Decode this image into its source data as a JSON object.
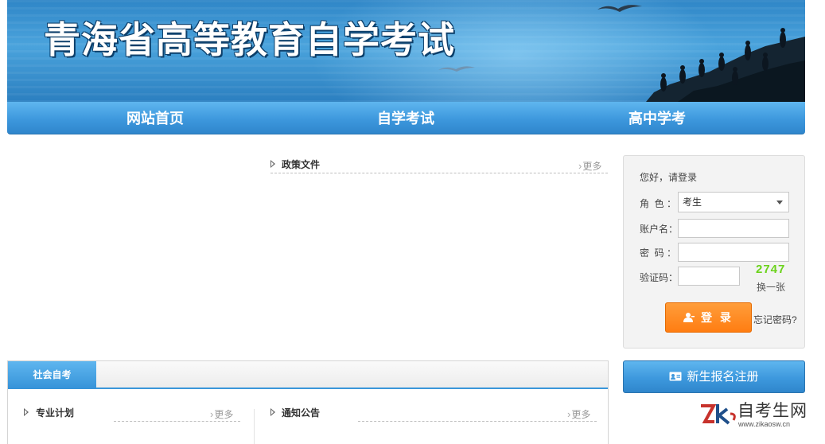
{
  "banner": {
    "title": "青海省高等教育自学考试"
  },
  "nav": {
    "items": [
      "网站首页",
      "自学考试",
      "高中学考"
    ]
  },
  "policy": {
    "title": "政策文件",
    "more": "更多"
  },
  "login": {
    "greeting": "您好，请登录",
    "role_label": "角  色 ：",
    "role_value": "考生",
    "account_label": "账户名：",
    "account_value": "",
    "password_label": "密  码 ：",
    "password_value": "",
    "captcha_label": "验证码：",
    "captcha_value": "",
    "captcha_code": "2747",
    "captcha_refresh": "换一张",
    "submit": "登 录",
    "forgot": "忘记密码?"
  },
  "register": {
    "label": "新生报名注册"
  },
  "panel": {
    "tab": "社会自考",
    "left": {
      "title": "专业计划",
      "more": "更多"
    },
    "right": {
      "title": "通知公告",
      "more": "更多"
    }
  },
  "watermark": {
    "name": "自考生网",
    "url": "www.zikaosw.cn"
  },
  "colors": {
    "primary_blue": "#3d98dd",
    "login_orange": "#ff8a20",
    "captcha_green": "#6bd31b"
  },
  "icons": {
    "login": "user-icon",
    "register": "id-card-icon",
    "section": "triangle-right-icon",
    "more": "chevron-right-icon"
  }
}
